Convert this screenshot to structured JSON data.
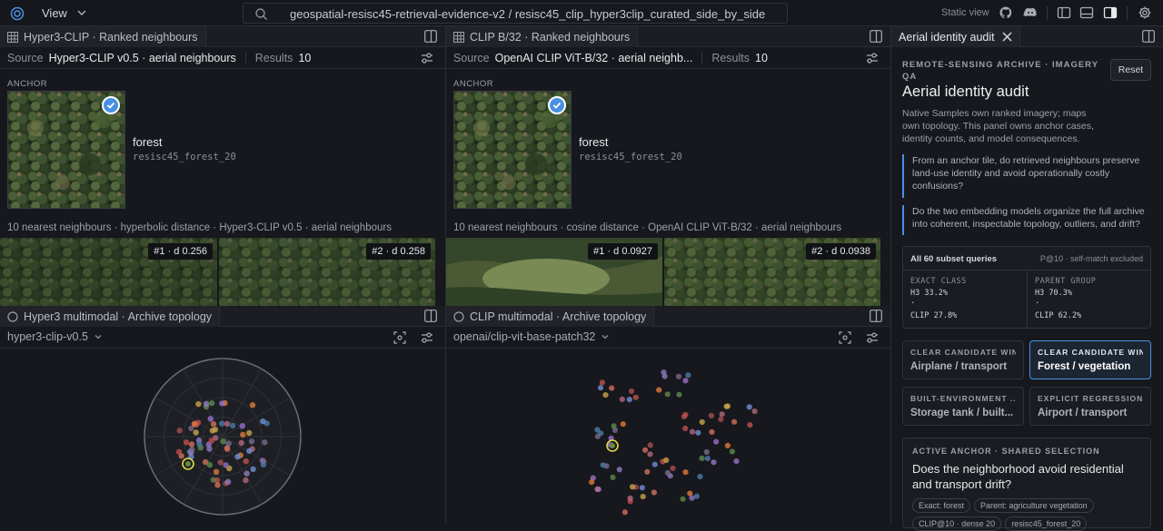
{
  "topbar": {
    "view_label": "View",
    "search_path": "geospatial-resisc45-retrieval-evidence-v2 / resisc45_clip_hyper3clip_curated_side_by_side",
    "static_view": "Static view"
  },
  "left_panel": {
    "tab_label": "Hyper3-CLIP · Ranked neighbours",
    "source_label": "Source",
    "source_value": "Hyper3-CLIP v0.5 · aerial neighbours",
    "results_label": "Results",
    "results_value": "10",
    "anchor_label": "ANCHOR",
    "anchor_class": "forest",
    "anchor_id": "resisc45_forest_20",
    "nn_caption": "10 nearest neighbours · hyperbolic distance · Hyper3-CLIP v0.5 · aerial neighbours",
    "neighbours": [
      {
        "badge": "#1 · d 0.256"
      },
      {
        "badge": "#2 · d 0.258"
      }
    ]
  },
  "mid_panel": {
    "tab_label": "CLIP B/32 · Ranked neighbours",
    "source_label": "Source",
    "source_value": "OpenAI CLIP ViT-B/32 · aerial neighb...",
    "results_label": "Results",
    "results_value": "10",
    "anchor_label": "ANCHOR",
    "anchor_class": "forest",
    "anchor_id": "resisc45_forest_20",
    "nn_caption": "10 nearest neighbours · cosine distance · OpenAI CLIP ViT-B/32 · aerial neighbours",
    "neighbours": [
      {
        "badge": "#1 · d 0.0927"
      },
      {
        "badge": "#2 · d 0.0938"
      }
    ]
  },
  "left_topology": {
    "tab_label": "Hyper3 multimodal · Archive topology",
    "model": "hyper3-clip-v0.5"
  },
  "mid_topology": {
    "tab_label": "CLIP multimodal · Archive topology",
    "model": "openai/clip-vit-base-patch32"
  },
  "audit": {
    "tab_label": "Aerial identity audit",
    "eyebrow_line1": "REMOTE-SENSING ARCHIVE · IMAGERY",
    "eyebrow_line2": "QA",
    "reset_label": "Reset",
    "title": "Aerial identity audit",
    "desc_line1": "Native Samples own ranked imagery; maps",
    "desc_line2": "own topology. This panel owns anchor cases,",
    "desc_line3": "identity counts, and model consequences.",
    "q1_line1": "From an anchor tile, do retrieved neighbours preserve",
    "q1_line2": "land-use identity and avoid operationally costly",
    "q1_line3": "confusions?",
    "q2_line1": "Do the two embedding models organize the full archive",
    "q2_line2": "into coherent, inspectable topology, outliers, and drift?",
    "stats": {
      "header": "All 60 subset queries",
      "header_right": "P@10 · self-match excluded",
      "exact_label": "EXACT CLASS",
      "exact_h3": "H3 33.2%",
      "exact_dot": ".",
      "exact_clip": "CLIP 27.8%",
      "parent_label": "PARENT GROUP",
      "parent_h3": "H3 70.3%",
      "parent_dot": ".",
      "parent_clip": "CLIP 62.2%"
    },
    "candidates": [
      {
        "eyebrow": "CLEAR CANDIDATE WIN",
        "value": "Airplane / transport"
      },
      {
        "eyebrow": "CLEAR CANDIDATE WIN",
        "value": "Forest / vegetation"
      },
      {
        "eyebrow": "BUILT-ENVIRONMENT ...",
        "value": "Storage tank / built..."
      },
      {
        "eyebrow": "EXPLICIT REGRESSION",
        "value": "Airport / transport"
      }
    ],
    "active": {
      "eyebrow": "ACTIVE ANCHOR · SHARED SELECTION",
      "question_line1": "Does the neighborhood avoid residential",
      "question_line2": "and transport drift?",
      "pill1": "Exact: forest",
      "pill2": "Parent: agriculture vegetation",
      "pill3": "CLIP@10 · dense 20",
      "pill4": "resisc45_forest_20"
    }
  },
  "colors": {
    "accent": "#4a90e2",
    "background": "#16181d",
    "anchor_ring": "#e5d84a"
  }
}
